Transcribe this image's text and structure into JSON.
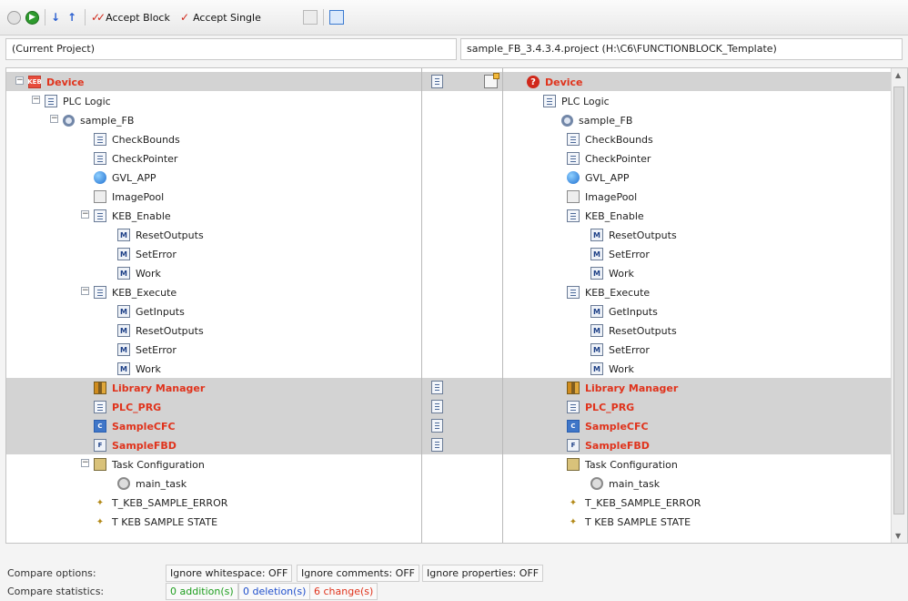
{
  "toolbar": {
    "accept_block_label": "Accept Block",
    "accept_single_label": "Accept Single"
  },
  "paths": {
    "left": "(Current Project)",
    "right": "sample_FB_3.4.3.4.project (H:\\C6\\FUNCTIONBLOCK_Template)"
  },
  "left_tree": {
    "device": "Device",
    "plc_logic": "PLC Logic",
    "app": "sample_FB",
    "check_bounds": "CheckBounds",
    "check_pointer": "CheckPointer",
    "gvl_app": "GVL_APP",
    "image_pool": "ImagePool",
    "keb_enable": "KEB_Enable",
    "enable_reset": "ResetOutputs",
    "enable_seterror": "SetError",
    "enable_work": "Work",
    "keb_execute": "KEB_Execute",
    "execute_getinputs": "GetInputs",
    "execute_reset": "ResetOutputs",
    "execute_seterror": "SetError",
    "execute_work": "Work",
    "library_manager": "Library Manager",
    "plc_prg": "PLC_PRG",
    "sample_cfc": "SampleCFC",
    "sample_fbd": "SampleFBD",
    "task_config": "Task Configuration",
    "main_task": "main_task",
    "t_error": "T_KEB_SAMPLE_ERROR",
    "t_state": "T KEB SAMPLE STATE"
  },
  "right_tree": {
    "device": "Device",
    "plc_logic": "PLC Logic",
    "app": "sample_FB",
    "check_bounds": "CheckBounds",
    "check_pointer": "CheckPointer",
    "gvl_app": "GVL_APP",
    "image_pool": "ImagePool",
    "keb_enable": "KEB_Enable",
    "enable_reset": "ResetOutputs",
    "enable_seterror": "SetError",
    "enable_work": "Work",
    "keb_execute": "KEB_Execute",
    "execute_getinputs": "GetInputs",
    "execute_reset": "ResetOutputs",
    "execute_seterror": "SetError",
    "execute_work": "Work",
    "library_manager": "Library Manager",
    "plc_prg": "PLC_PRG",
    "sample_cfc": "SampleCFC",
    "sample_fbd": "SampleFBD",
    "task_config": "Task Configuration",
    "main_task": "main_task",
    "t_error": "T_KEB_SAMPLE_ERROR",
    "t_state": "T KEB SAMPLE STATE"
  },
  "footer": {
    "options_label": "Compare options:",
    "ignore_whitespace": "Ignore whitespace: OFF",
    "ignore_comments": "Ignore comments: OFF",
    "ignore_properties": "Ignore properties: OFF",
    "statistics_label": "Compare statistics:",
    "additions": "0 addition(s)",
    "deletions": "0 deletion(s)",
    "changes": "6 change(s)"
  },
  "colors": {
    "changed_text": "#e0331c",
    "changed_row": "#d3d3d3",
    "additions": "#1e9e1e",
    "deletions": "#1f4fcc",
    "changes": "#e0331c"
  }
}
